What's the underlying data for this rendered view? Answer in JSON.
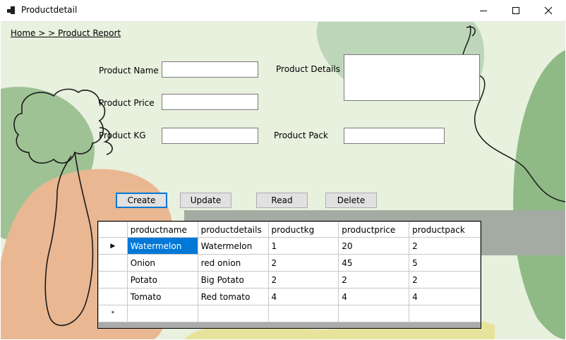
{
  "window": {
    "title": "Productdetail",
    "controls": {
      "minimize": "—",
      "maximize": "☐",
      "close": "✕"
    }
  },
  "breadcrumb": "Home > > Product Report",
  "form": {
    "product_name_label": "Product Name",
    "product_details_label": "Product Details",
    "product_price_label": "Product Price",
    "product_kg_label": "Product KG",
    "product_pack_label": "Product Pack",
    "product_name_value": "",
    "product_details_value": "",
    "product_price_value": "",
    "product_kg_value": "",
    "product_pack_value": ""
  },
  "buttons": {
    "create": "Create",
    "update": "Update",
    "read": "Read",
    "delete": "Delete"
  },
  "grid": {
    "columns": [
      "productname",
      "productdetails",
      "productkg",
      "productprice",
      "productpack"
    ],
    "rows": [
      [
        "Watermelon",
        "Watermelon",
        "1",
        "20",
        "2"
      ],
      [
        "Onion",
        "red onion",
        "2",
        "45",
        "5"
      ],
      [
        "Potato",
        "Big Potato",
        "2",
        "2",
        "2"
      ],
      [
        "Tomato",
        "Red tomato",
        "4",
        "4",
        "4"
      ]
    ],
    "current_row_marker": "▶",
    "new_row_marker": "*"
  },
  "colors": {
    "background": "#e8f0de",
    "selection": "#0078d7",
    "shape_green": "#8fba86",
    "shape_peach": "#e9b792"
  }
}
